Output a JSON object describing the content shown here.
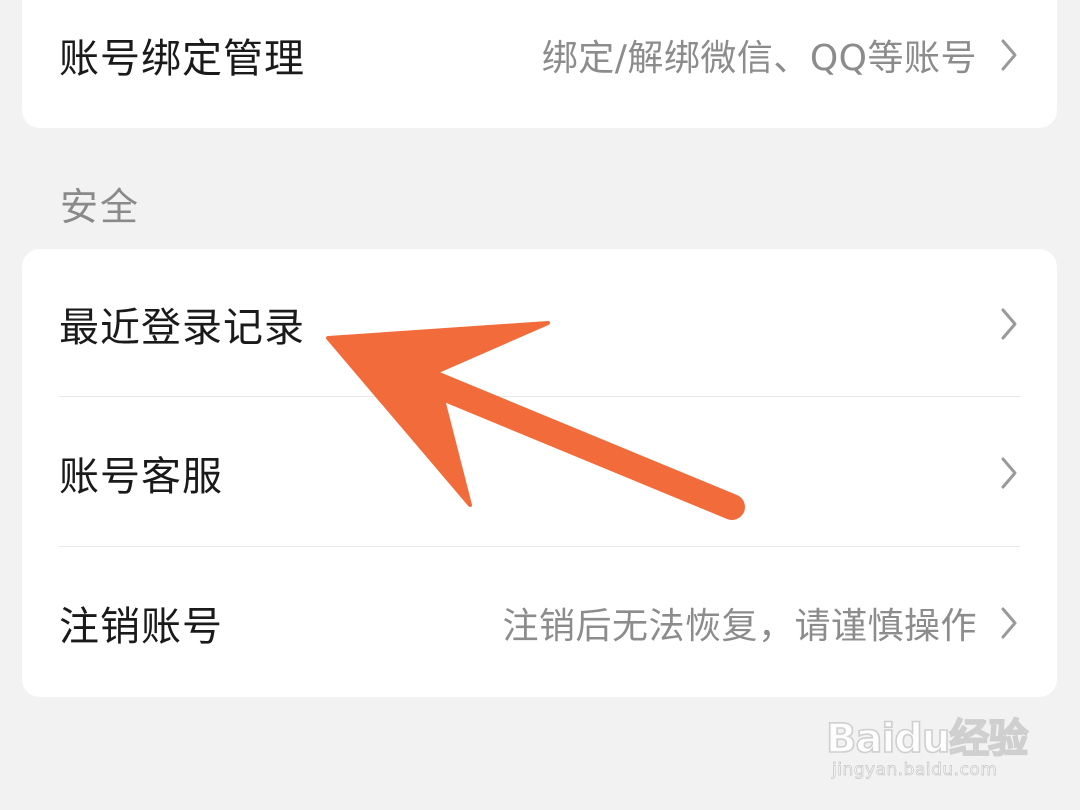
{
  "account_binding": {
    "label": "账号绑定管理",
    "description": "绑定/解绑微信、QQ等账号"
  },
  "security_section": {
    "title": "安全",
    "items": [
      {
        "label": "最近登录记录",
        "description": ""
      },
      {
        "label": "账号客服",
        "description": ""
      },
      {
        "label": "注销账号",
        "description": "注销后无法恢复，请谨慎操作"
      }
    ]
  },
  "annotation": {
    "arrow_color": "#f26b3a"
  },
  "watermark": {
    "logo": "Baidu经验",
    "url": "jingyan.baidu.com"
  },
  "colors": {
    "background": "#f2f2f2",
    "card": "#ffffff",
    "primary_text": "#1a1a1a",
    "secondary_text": "#8c8c8c",
    "chevron": "#9a9a9a"
  }
}
